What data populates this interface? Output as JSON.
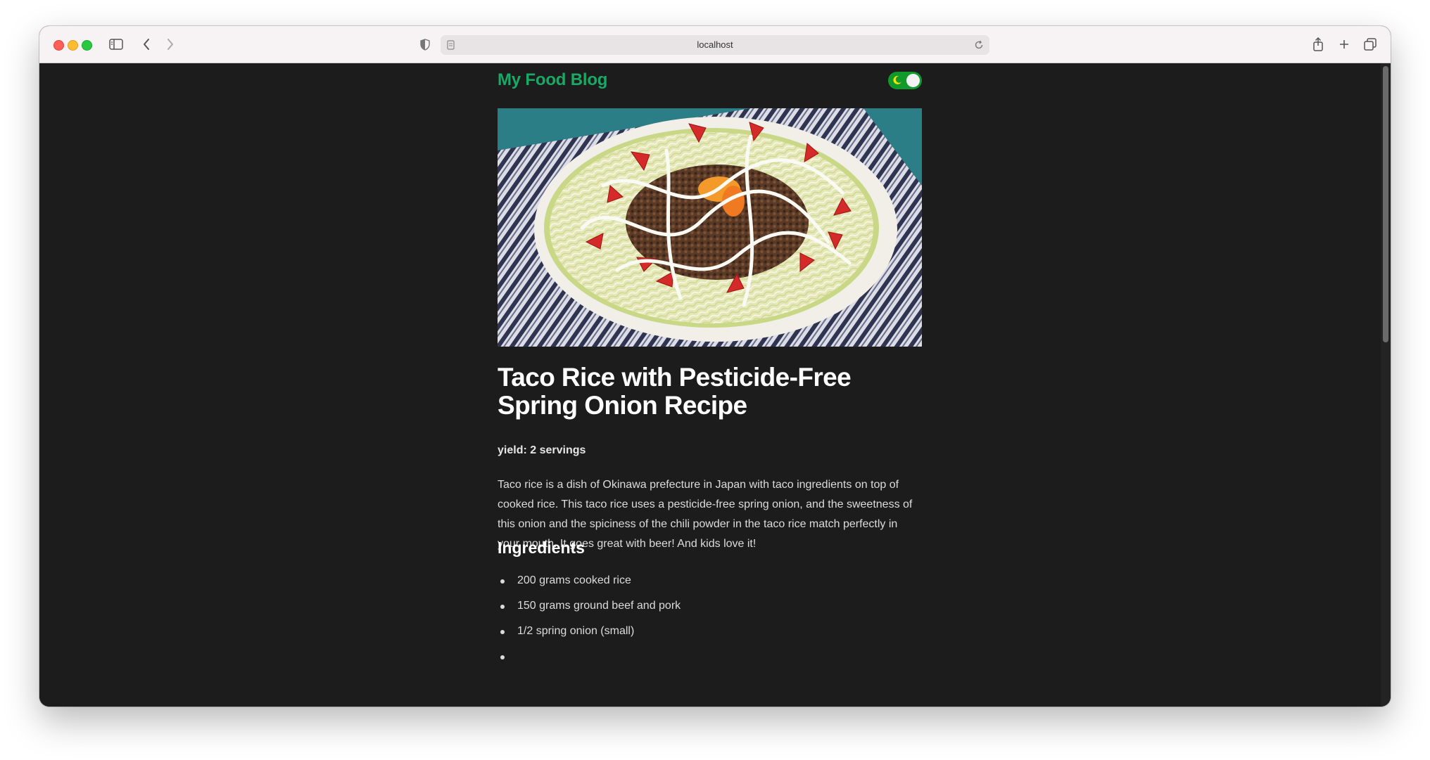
{
  "browser": {
    "url": "localhost"
  },
  "site": {
    "brand": "My Food Blog"
  },
  "recipe": {
    "title": "Taco Rice with Pesticide-Free Spring Onion Recipe",
    "yield": "yield: 2 servings",
    "description": "Taco rice is a dish of Okinawa prefecture in Japan with taco ingredients on top of cooked rice. This taco rice uses a pesticide-free spring onion, and the sweetness of this onion and the spiciness of the chili powder in the taco rice match perfectly in your mouth. It goes great with beer! And kids love it!",
    "ingredients_heading": "Ingredients",
    "ingredients": [
      "200 grams cooked rice",
      "150 grams ground beef and pork",
      "1/2 spring onion (small)",
      ""
    ]
  },
  "colors": {
    "brand": "#1aa865",
    "background": "#1c1c1c",
    "toggle": "#119a2c"
  },
  "icons": [
    "sidebar-icon",
    "back-icon",
    "forward-icon",
    "privacy-shield-icon",
    "page-icon",
    "reload-icon",
    "share-icon",
    "new-tab-icon",
    "tabs-overview-icon",
    "moon-icon"
  ]
}
